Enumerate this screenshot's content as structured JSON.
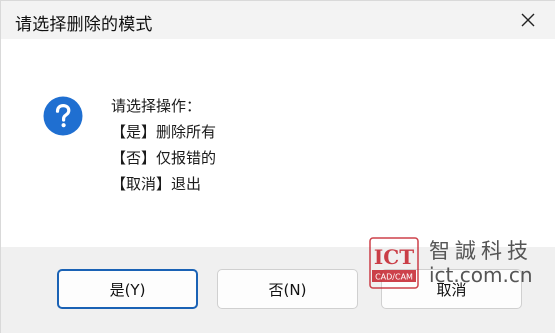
{
  "window": {
    "title": "请选择删除的模式",
    "close_label": "×"
  },
  "message": {
    "icon": "question-icon",
    "lines": [
      "请选择操作：",
      "【是】删除所有",
      "【否】仅报错的",
      "【取消】退出"
    ]
  },
  "buttons": {
    "yes": "是(Y)",
    "no": "否(N)",
    "cancel": "取消"
  },
  "watermark": {
    "logo_text": "ICT",
    "logo_subtext": "CAD/CAM",
    "brand": "智誠科技",
    "url": "ict.com.cn"
  },
  "colors": {
    "accent": "#1a62b5",
    "icon_blue": "#1f6fd1",
    "watermark_red": "#c4202a"
  }
}
